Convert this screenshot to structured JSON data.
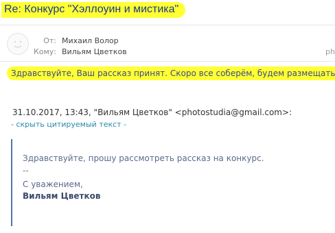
{
  "email": {
    "subject": "Re: Конкурс \"Хэллоуин и мистика\"",
    "from_label": "От:",
    "from_value": "Михаил Волор",
    "to_label": "Кому:",
    "to_value": "Вильям Цветков",
    "truncated_right": "ph",
    "reply_text": "Здравствуйте, Ваш рассказ принят. Скоро все соберём, будем размещать.",
    "quote_header": "31.10.2017, 13:43, \"Вильям Цветков\" <photostudia@gmail.com>:",
    "hide_quote_link": "- скрыть цитируемый текст -",
    "quoted": {
      "body": "Здравствуйте, прошу рассмотреть рассказ на конкурс.",
      "separator": "--",
      "regards": "С уважением,",
      "signature": "Вильям Цветков"
    }
  },
  "highlight_color": "#ffff33",
  "accent_color": "#2a8aaa"
}
